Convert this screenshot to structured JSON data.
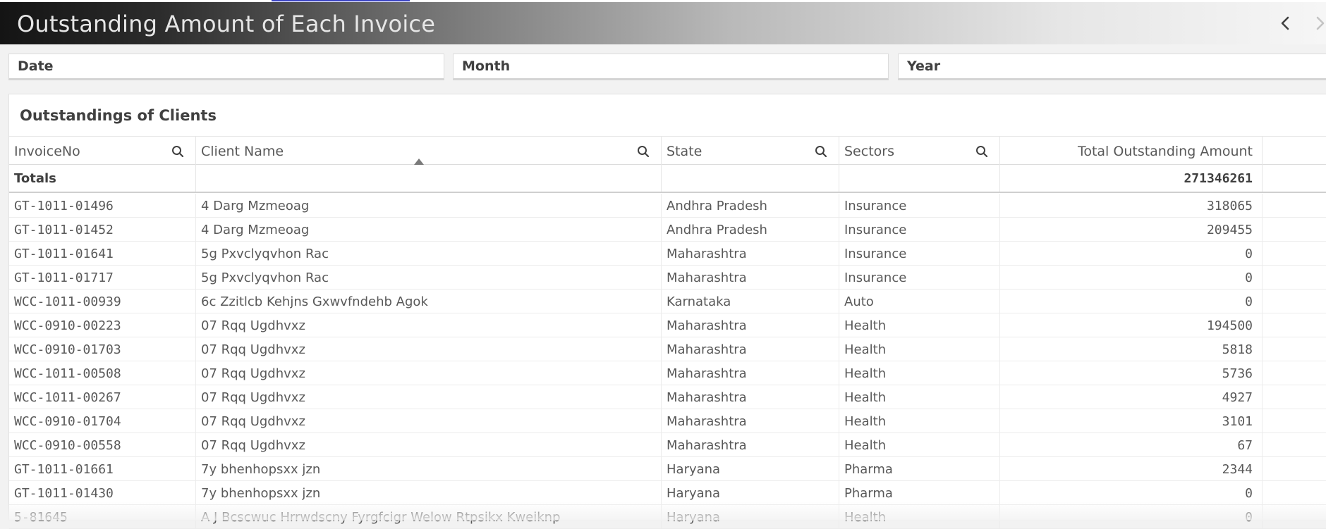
{
  "header": {
    "title": "Outstanding Amount of Each Invoice"
  },
  "filters": {
    "date": "Date",
    "month": "Month",
    "year": "Year"
  },
  "panel": {
    "title": "Outstandings of Clients"
  },
  "table": {
    "columns": [
      "InvoiceNo",
      "Client Name",
      "State",
      "Sectors",
      "Total Outstanding Amount"
    ],
    "totals_label": "Totals",
    "totals_value": "271346261",
    "rows": [
      [
        "GT-1011-01496",
        "4 Darg Mzmeoag",
        "Andhra Pradesh",
        "Insurance",
        "318065"
      ],
      [
        "GT-1011-01452",
        "4 Darg Mzmeoag",
        "Andhra Pradesh",
        "Insurance",
        "209455"
      ],
      [
        "GT-1011-01641",
        "5g Pxvclyqvhon Rac",
        "Maharashtra",
        "Insurance",
        "0"
      ],
      [
        "GT-1011-01717",
        "5g Pxvclyqvhon Rac",
        "Maharashtra",
        "Insurance",
        "0"
      ],
      [
        "WCC-1011-00939",
        "6c Zzitlcb Kehjns Gxwvfndehb Agok",
        "Karnataka",
        "Auto",
        "0"
      ],
      [
        "WCC-0910-00223",
        "07 Rqq Ugdhvxz",
        "Maharashtra",
        "Health",
        "194500"
      ],
      [
        "WCC-0910-01703",
        "07 Rqq Ugdhvxz",
        "Maharashtra",
        "Health",
        "5818"
      ],
      [
        "WCC-1011-00508",
        "07 Rqq Ugdhvxz",
        "Maharashtra",
        "Health",
        "5736"
      ],
      [
        "WCC-1011-00267",
        "07 Rqq Ugdhvxz",
        "Maharashtra",
        "Health",
        "4927"
      ],
      [
        "WCC-0910-01704",
        "07 Rqq Ugdhvxz",
        "Maharashtra",
        "Health",
        "3101"
      ],
      [
        "WCC-0910-00558",
        "07 Rqq Ugdhvxz",
        "Maharashtra",
        "Health",
        "67"
      ],
      [
        "GT-1011-01661",
        "7y bhenhopsxx jzn",
        "Haryana",
        "Pharma",
        "2344"
      ],
      [
        "GT-1011-01430",
        "7y bhenhopsxx jzn",
        "Haryana",
        "Pharma",
        "0"
      ],
      [
        "5-81645",
        "A J Bcscwuc Hrrwdscny Fyrgfcigr Welow Rtpsikx Kweiknp",
        "Haryana",
        "Health",
        "0"
      ]
    ]
  },
  "icons": {
    "search": "search-icon",
    "prev": "chevron-left-icon",
    "next": "chevron-right-icon",
    "sort": "sort-ascending-icon"
  },
  "colors": {
    "header_dark": "#141414",
    "header_light": "#f6f6f6",
    "text": "#595959"
  }
}
